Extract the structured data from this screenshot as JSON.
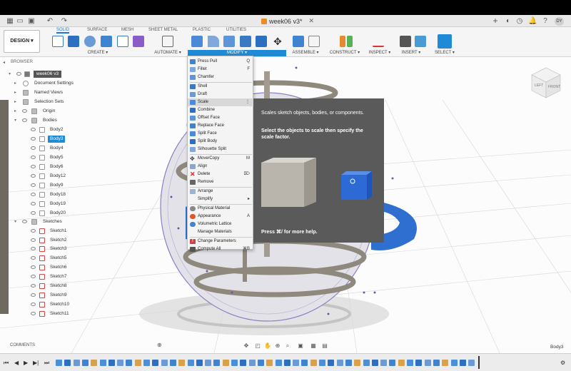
{
  "window": {
    "doc_tab_title": "week06 v3*",
    "avatar_initials": "DY"
  },
  "toolbar": {
    "workspace_label": "DESIGN ▾",
    "tabs": [
      "SOLID",
      "SURFACE",
      "MESH",
      "SHEET METAL",
      "PLASTIC",
      "UTILITIES"
    ],
    "active_tab": "SOLID",
    "groups": [
      "CREATE ▾",
      "AUTOMATE ▾",
      "MODIFY ▾",
      "ASSEMBLE ▾",
      "CONSTRUCT ▾",
      "INSPECT ▾",
      "INSERT ▾",
      "SELECT ▾"
    ],
    "accent": "#1f8ad6"
  },
  "browser": {
    "title": "BROWSER",
    "root": "week06 v3",
    "items": [
      {
        "label": "Document Settings"
      },
      {
        "label": "Named Views"
      },
      {
        "label": "Selection Sets"
      },
      {
        "label": "Origin"
      },
      {
        "label": "Bodies"
      },
      {
        "label": "Body2"
      },
      {
        "label": "Body3"
      },
      {
        "label": "Body4"
      },
      {
        "label": "Body5"
      },
      {
        "label": "Body6"
      },
      {
        "label": "Body12"
      },
      {
        "label": "Body9"
      },
      {
        "label": "Body18"
      },
      {
        "label": "Body19"
      },
      {
        "label": "Body20"
      },
      {
        "label": "Sketches"
      },
      {
        "label": "Sketch1"
      },
      {
        "label": "Sketch2"
      },
      {
        "label": "Sketch3"
      },
      {
        "label": "Sketch5"
      },
      {
        "label": "Sketch6"
      },
      {
        "label": "Sketch7"
      },
      {
        "label": "Sketch8"
      },
      {
        "label": "Sketch9"
      },
      {
        "label": "Sketch10"
      },
      {
        "label": "Sketch11"
      }
    ],
    "comments_label": "COMMENTS"
  },
  "modify_menu": {
    "items": [
      {
        "label": "Press Pull",
        "key": "Q"
      },
      {
        "label": "Fillet",
        "key": "F"
      },
      {
        "label": "Chamfer",
        "key": ""
      },
      {
        "label": "Shell",
        "key": ""
      },
      {
        "label": "Draft",
        "key": ""
      },
      {
        "label": "Scale",
        "key": "⋮"
      },
      {
        "label": "Combine",
        "key": ""
      },
      {
        "label": "Offset Face",
        "key": ""
      },
      {
        "label": "Replace Face",
        "key": ""
      },
      {
        "label": "Split Face",
        "key": ""
      },
      {
        "label": "Split Body",
        "key": ""
      },
      {
        "label": "Silhouette Split",
        "key": ""
      },
      {
        "label": "Move/Copy",
        "key": "M"
      },
      {
        "label": "Align",
        "key": ""
      },
      {
        "label": "Delete",
        "key": "⌦"
      },
      {
        "label": "Remove",
        "key": ""
      },
      {
        "label": "Arrange",
        "key": ""
      },
      {
        "label": "Simplify",
        "key": "▸"
      },
      {
        "label": "Physical Material",
        "key": ""
      },
      {
        "label": "Appearance",
        "key": "A"
      },
      {
        "label": "Volumetric Lattice",
        "key": ""
      },
      {
        "label": "Manage Materials",
        "key": ""
      },
      {
        "label": "Change Parameters",
        "key": ""
      },
      {
        "label": "Compute All",
        "key": "⌘B"
      }
    ]
  },
  "tooltip": {
    "title": "Scales sketch objects, bodies, or components.",
    "body": "Select the objects to scale then specify the scale factor.",
    "footer": "Press ⌘/ for more help."
  },
  "status": {
    "selection_label": "Body3"
  },
  "viewcube": {
    "left": "LEFT",
    "front": "FRONT"
  }
}
